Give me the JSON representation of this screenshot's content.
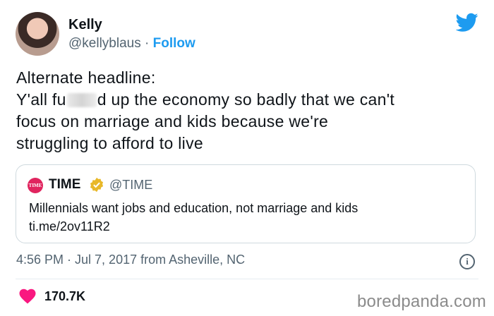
{
  "author": {
    "name": "Kelly",
    "handle": "@kellyblaus",
    "separator": "·",
    "follow_label": "Follow"
  },
  "tweet": {
    "lines": [
      "Alternate headline:",
      "Y'all fu",
      "d up the economy so badly that we can't",
      "focus on marriage and kids because we're",
      "struggling to afford to live"
    ]
  },
  "quoted_tweet": {
    "logo_text": "TIME",
    "name": "TIME",
    "handle": "@TIME",
    "text": "Millennials want jobs and education, not marriage and kids",
    "link": "ti.me/2ov11R2"
  },
  "meta": {
    "timestamp": "4:56 PM · Jul 7, 2017 from Asheville, NC",
    "info_glyph": "i",
    "likes": "170.7K"
  },
  "watermark": "boredpanda.com",
  "colors": {
    "accent": "#1d9bf0",
    "heart": "#f91880",
    "muted": "#536471",
    "verified": "#e8b829"
  },
  "icons": [
    "twitter-bird-icon",
    "verified-badge-icon",
    "info-icon",
    "heart-icon"
  ]
}
